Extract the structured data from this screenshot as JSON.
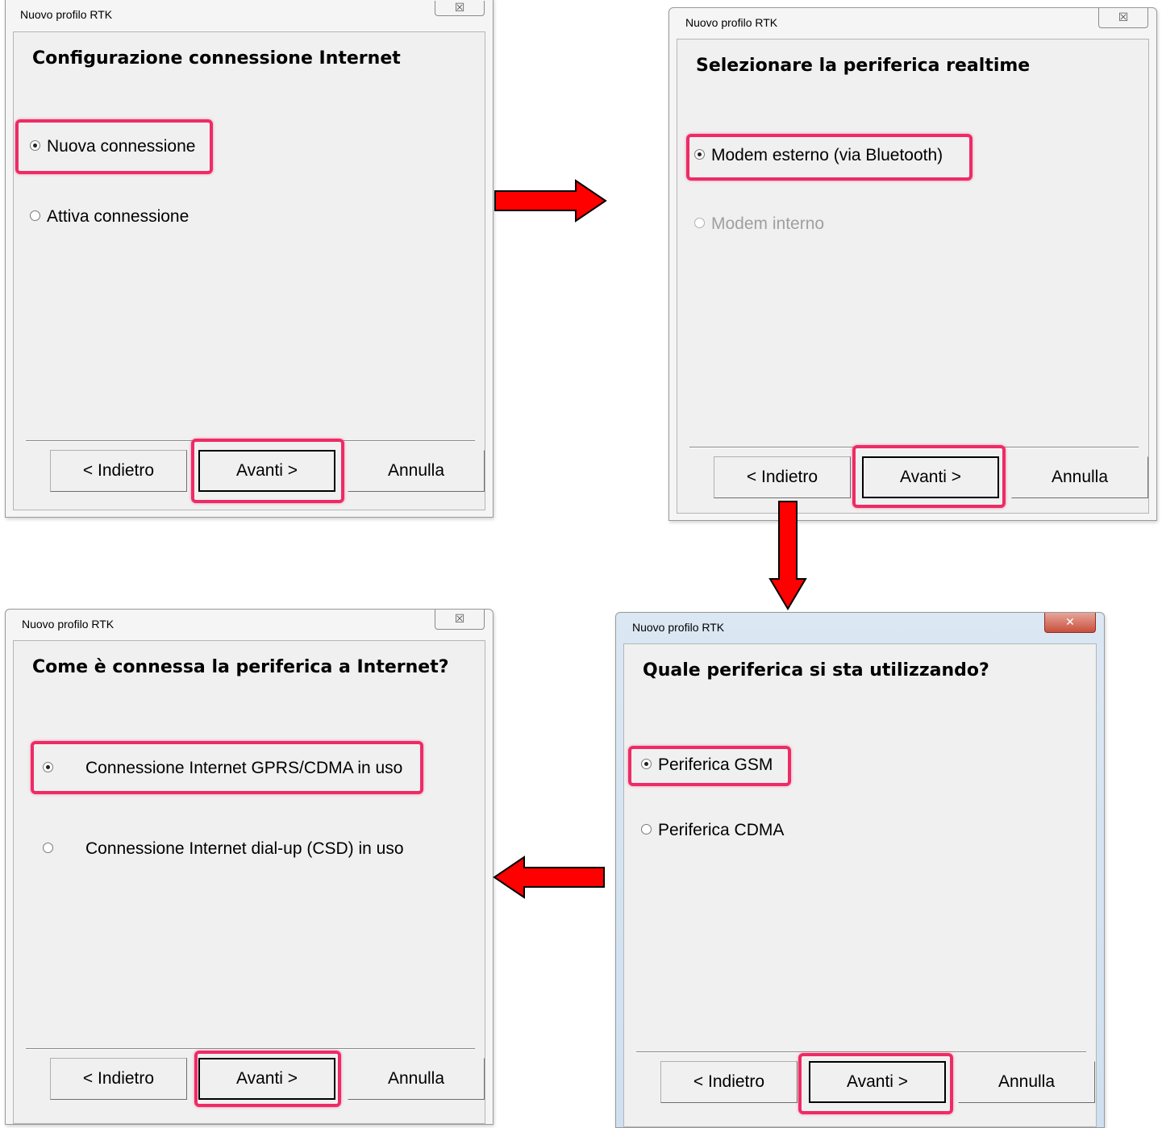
{
  "dialogs": [
    {
      "title": "Nuovo profilo RTK",
      "close": "☒",
      "heading": "Configurazione connessione Internet",
      "options": [
        {
          "label": "Nuova connessione",
          "selected": true
        },
        {
          "label": "Attiva connessione",
          "selected": false
        }
      ],
      "buttons": {
        "back": "< Indietro",
        "next": "Avanti >",
        "cancel": "Annulla"
      }
    },
    {
      "title": "Nuovo profilo RTK",
      "close": "☒",
      "heading": "Selezionare la periferica realtime",
      "options": [
        {
          "label": "Modem esterno (via Bluetooth)",
          "selected": true
        },
        {
          "label": "Modem interno",
          "selected": false,
          "disabled": true
        }
      ],
      "buttons": {
        "back": "< Indietro",
        "next": "Avanti >",
        "cancel": "Annulla"
      }
    },
    {
      "title": "Nuovo profilo RTK",
      "close": "☒",
      "heading": "Come è connessa la periferica a Internet?",
      "options": [
        {
          "label": "Connessione Internet GPRS/CDMA in uso",
          "selected": true
        },
        {
          "label": "Connessione Internet dial-up (CSD) in uso",
          "selected": false
        }
      ],
      "buttons": {
        "back": "< Indietro",
        "next": "Avanti >",
        "cancel": "Annulla"
      }
    },
    {
      "title": "Nuovo profilo RTK",
      "close": "✕",
      "heading": "Quale periferica si sta utilizzando?",
      "options": [
        {
          "label": "Periferica GSM",
          "selected": true
        },
        {
          "label": "Periferica CDMA",
          "selected": false
        }
      ],
      "buttons": {
        "back": "< Indietro",
        "next": "Avanti >",
        "cancel": "Annulla"
      }
    }
  ],
  "colors": {
    "highlight": "#ee2b66",
    "arrow": "#ff0000"
  }
}
